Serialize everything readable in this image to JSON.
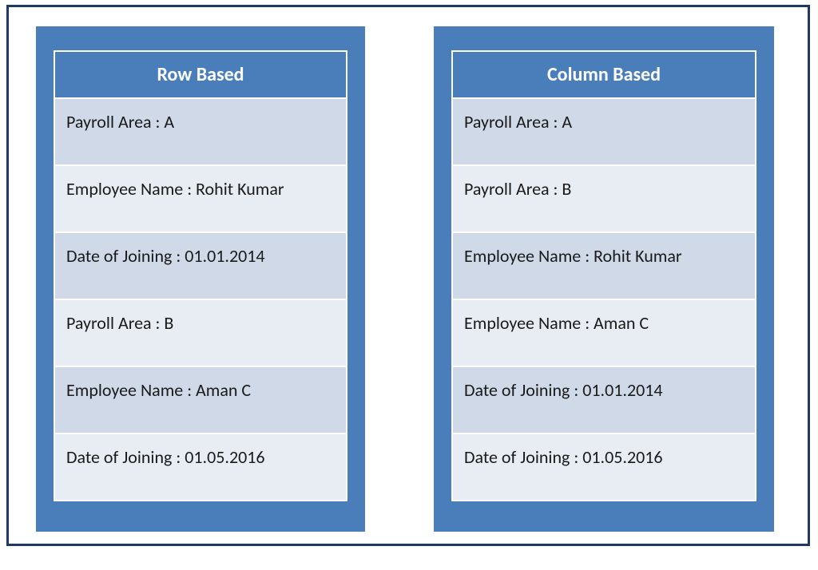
{
  "panels": {
    "rowBased": {
      "title": "Row Based",
      "rows": [
        "Payroll Area : A",
        "Employee Name : Rohit Kumar",
        "Date of Joining : 01.01.2014",
        "Payroll Area : B",
        "Employee Name : Aman C",
        "Date of Joining : 01.05.2016"
      ]
    },
    "columnBased": {
      "title": "Column Based",
      "rows": [
        "Payroll Area : A",
        "Payroll Area : B",
        "Employee Name : Rohit Kumar",
        "Employee Name : Aman C",
        "Date of Joining : 01.01.2014",
        "Date of Joining : 01.05.2016"
      ]
    }
  }
}
